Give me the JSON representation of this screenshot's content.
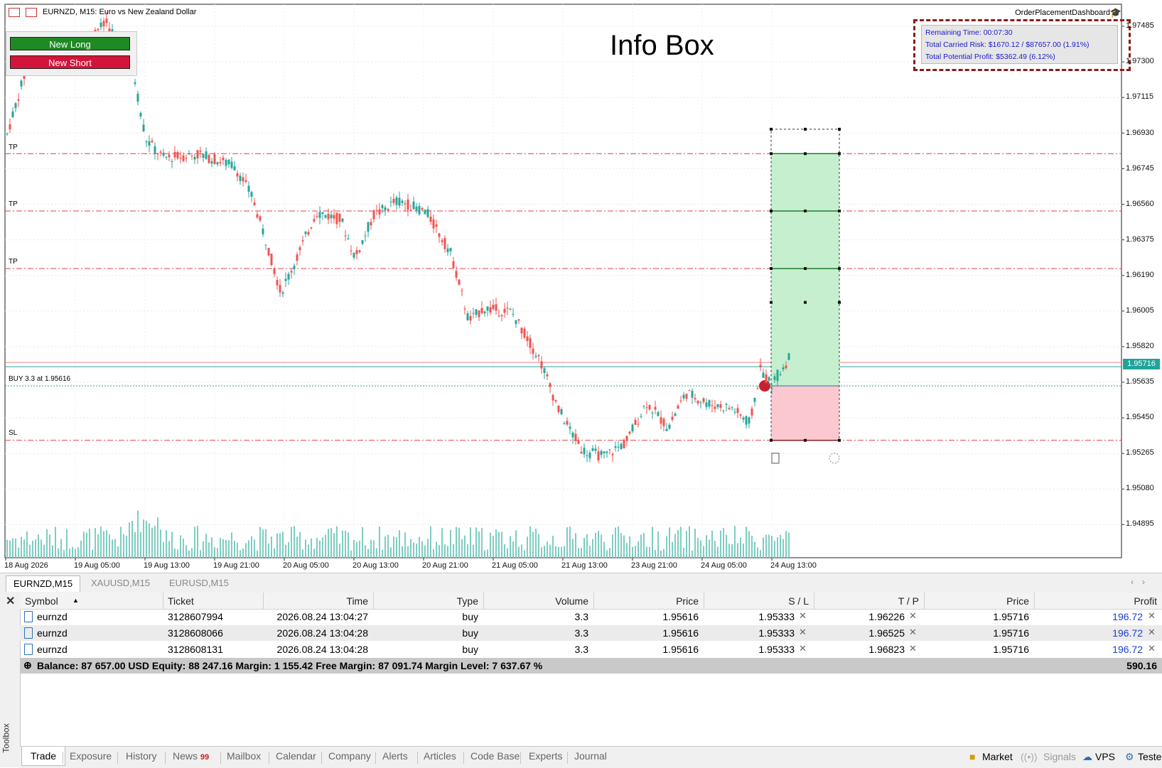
{
  "chart_header": {
    "title": "EURNZD, M15:  Euro vs New Zealand Dollar",
    "dashboard": "OrderPlacementDashboard"
  },
  "trade_buttons": {
    "long": "New Long",
    "short": "New Short",
    "long_color": "#1e8a23",
    "short_color": "#d3143a"
  },
  "info_box": {
    "remaining_time": "Remaining Time: 00:07:30",
    "carried_risk": "Total Carried Risk: $1670.12 / $87657.00 (1.91%)",
    "potential_profit": "Total Potential Profit: $5362.49 (6.12%)"
  },
  "annotation": {
    "text": "Info Box"
  },
  "chart_lines": {
    "tp_label": "TP",
    "sl_label": "SL",
    "buy_label": "BUY 3.3 at 1.95616",
    "current_price": "1.95716"
  },
  "y_axis": [
    "1.97485",
    "1.97300",
    "1.97115",
    "1.96930",
    "1.96745",
    "1.96560",
    "1.96375",
    "1.96190",
    "1.96005",
    "1.95820",
    "1.95635",
    "1.95450",
    "1.95265",
    "1.95080",
    "1.94895"
  ],
  "x_axis": [
    "18 Aug 2026",
    "19 Aug 05:00",
    "19 Aug 13:00",
    "19 Aug 21:00",
    "20 Aug 05:00",
    "20 Aug 13:00",
    "20 Aug 21:00",
    "21 Aug 05:00",
    "21 Aug 13:00",
    "23 Aug 21:00",
    "24 Aug 05:00",
    "24 Aug 13:00"
  ],
  "chart_tabs": [
    "EURNZD,M15",
    "XAUUSD,M15",
    "EURUSD,M15"
  ],
  "toolbox": {
    "side_label": "Toolbox",
    "columns": [
      "Symbol",
      "Ticket",
      "Time",
      "Type",
      "Volume",
      "Price",
      "S / L",
      "T / P",
      "Price",
      "Profit"
    ],
    "rows": [
      {
        "symbol": "eurnzd",
        "ticket": "3128607994",
        "time": "2026.08.24 13:04:27",
        "type": "buy",
        "volume": "3.3",
        "price": "1.95616",
        "sl": "1.95333",
        "tp": "1.96226",
        "cur": "1.95716",
        "profit": "196.72"
      },
      {
        "symbol": "eurnzd",
        "ticket": "3128608066",
        "time": "2026.08.24 13:04:28",
        "type": "buy",
        "volume": "3.3",
        "price": "1.95616",
        "sl": "1.95333",
        "tp": "1.96525",
        "cur": "1.95716",
        "profit": "196.72"
      },
      {
        "symbol": "eurnzd",
        "ticket": "3128608131",
        "time": "2026.08.24 13:04:28",
        "type": "buy",
        "volume": "3.3",
        "price": "1.95616",
        "sl": "1.95333",
        "tp": "1.96823",
        "cur": "1.95716",
        "profit": "196.72"
      }
    ],
    "balance": "Balance: 87 657.00 USD  Equity: 88 247.16  Margin: 1 155.42  Free Margin: 87 091.74  Margin Level: 7 637.67 %",
    "total_profit": "590.16",
    "tabs": [
      "Trade",
      "Exposure",
      "History",
      "News",
      "Mailbox",
      "Calendar",
      "Company",
      "Alerts",
      "Articles",
      "Code Base",
      "Experts",
      "Journal"
    ],
    "news_badge": "99",
    "status": {
      "market": "Market",
      "signals": "Signals",
      "vps": "VPS",
      "tester": "Tester"
    }
  }
}
